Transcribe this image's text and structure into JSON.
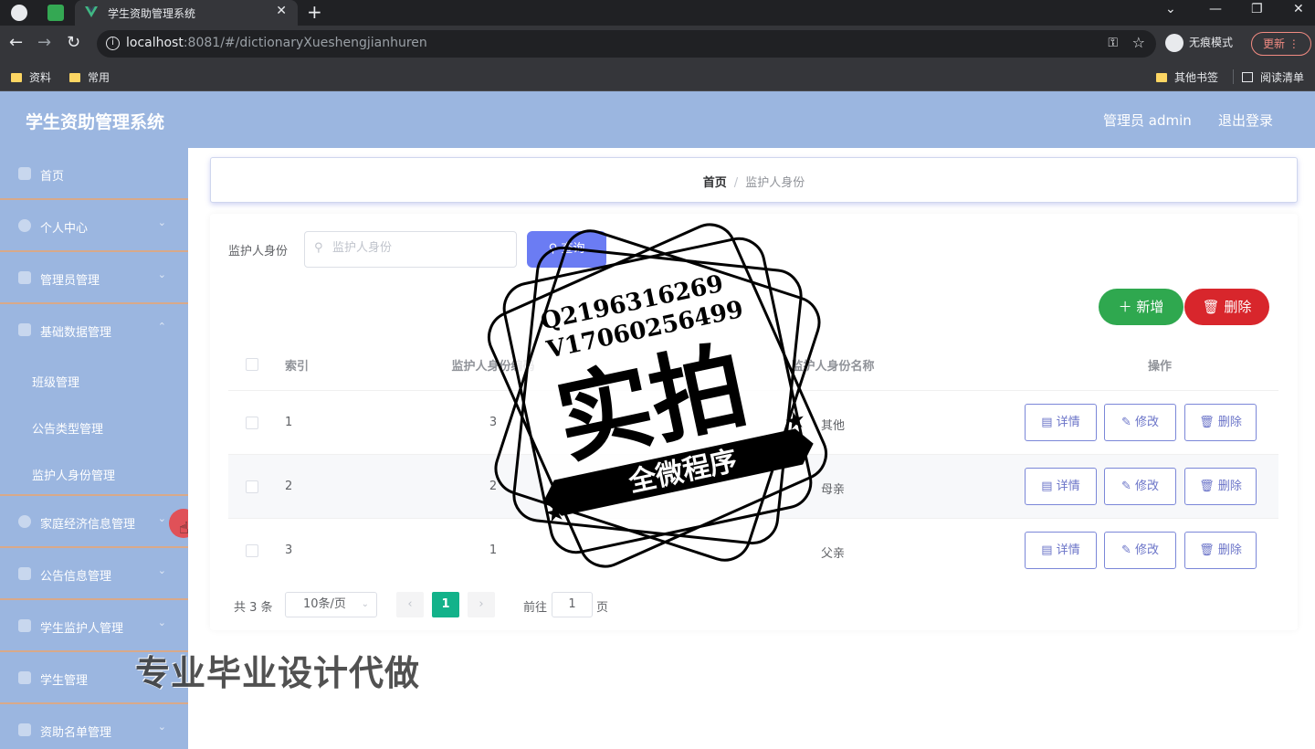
{
  "browser": {
    "tab_title": "学生资助管理系统",
    "new_tab_symbol": "+",
    "url_host": "localhost",
    "url_rest": ":8081/#/dictionaryXueshengjianhuren",
    "incognito_label": "无痕模式",
    "update_label": "更新 ⋮",
    "bookmarks": [
      "资料",
      "常用"
    ],
    "other_bookmarks": "其他书签",
    "reading_list": "阅读清单"
  },
  "header": {
    "title": "学生资助管理系统",
    "admin_label": "管理员 admin",
    "logout_label": "退出登录"
  },
  "sidebar": {
    "items": [
      {
        "label": "首页"
      },
      {
        "label": "个人中心"
      },
      {
        "label": "管理员管理"
      },
      {
        "label": "基础数据管理"
      }
    ],
    "sub_items": [
      {
        "label": "班级管理"
      },
      {
        "label": "公告类型管理"
      },
      {
        "label": "监护人身份管理"
      }
    ],
    "items_after": [
      {
        "label": "家庭经济信息管理"
      },
      {
        "label": "公告信息管理"
      },
      {
        "label": "学生监护人管理"
      },
      {
        "label": "学生管理"
      },
      {
        "label": "资助名单管理"
      }
    ]
  },
  "breadcrumb": {
    "home": "首页",
    "separator": "/",
    "current": "监护人身份"
  },
  "search": {
    "label": "监护人身份",
    "placeholder": "监护人身份",
    "button_label": "查询"
  },
  "actions": {
    "add_label": "新增",
    "delete_label": "删除"
  },
  "table": {
    "headers": {
      "index": "索引",
      "code": "监护人身份编码",
      "name": "监护人身份名称",
      "operation": "操作"
    },
    "rows": [
      {
        "index": "1",
        "code": "3",
        "name": "其他"
      },
      {
        "index": "2",
        "code": "2",
        "name": "母亲"
      },
      {
        "index": "3",
        "code": "1",
        "name": "父亲"
      }
    ],
    "row_actions": {
      "detail": "详情",
      "edit": "修改",
      "delete": "删除"
    }
  },
  "pagination": {
    "total_text": "共 3 条",
    "page_size": "10条/页",
    "current_page": "1",
    "goto_prefix": "前往",
    "goto_value": "1",
    "goto_suffix": "页"
  },
  "overlay": {
    "stamp_line1": "Q2196316269",
    "stamp_line2": "V17060256499",
    "stamp_big": "实拍",
    "stamp_ribbon": "全微程序",
    "banner": "专业毕业设计代做"
  },
  "colors": {
    "header_bg": "#9bb6e0",
    "accent": "#6b7cf3",
    "add_green": "#2fa84f",
    "delete_red": "#d8262c",
    "pager_active": "#13b28a"
  }
}
